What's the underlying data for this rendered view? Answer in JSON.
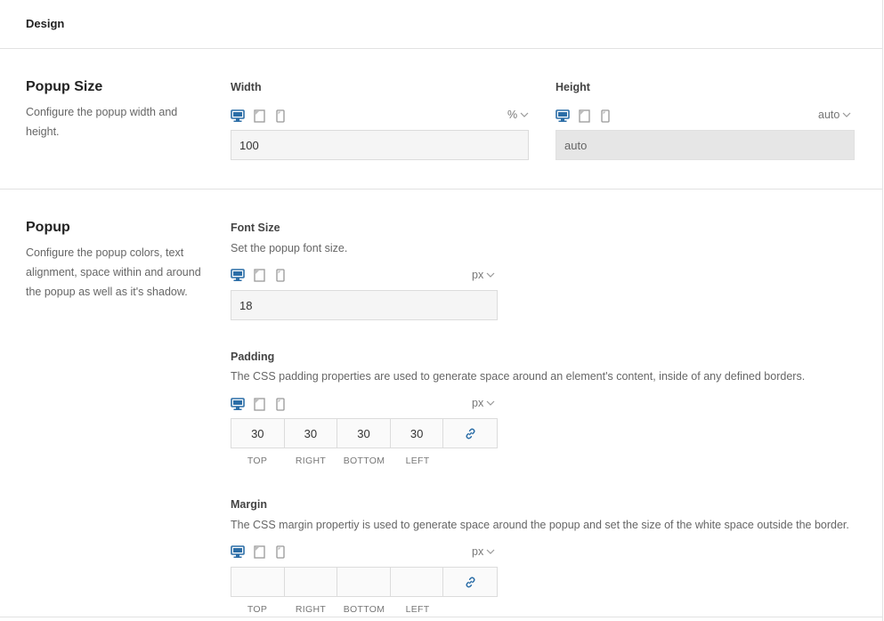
{
  "header": {
    "title": "Design"
  },
  "colors": {
    "accent": "#2c6ea7",
    "divider": "#e2e2e2",
    "input_bg": "#f5f5f5",
    "disabled_bg": "#e6e6e6"
  },
  "popup_size": {
    "title": "Popup Size",
    "description": "Configure the popup width and height.",
    "width": {
      "label": "Width",
      "unit": "%",
      "value": "100",
      "devices": [
        "desktop-icon",
        "tablet-icon",
        "mobile-icon"
      ]
    },
    "height": {
      "label": "Height",
      "unit": "auto",
      "value": "auto",
      "devices": [
        "desktop-icon",
        "tablet-icon",
        "mobile-icon"
      ]
    }
  },
  "popup": {
    "title": "Popup",
    "description": "Configure the popup colors, text alignment, space within and around the popup as well as it's shadow.",
    "font_size": {
      "label": "Font Size",
      "help": "Set the popup font size.",
      "unit": "px",
      "value": "18"
    },
    "padding": {
      "label": "Padding",
      "help": "The CSS padding properties are used to generate space around an element's content, inside of any defined borders.",
      "unit": "px",
      "values": {
        "top": "30",
        "right": "30",
        "bottom": "30",
        "left": "30"
      },
      "sides": {
        "top": "TOP",
        "right": "RIGHT",
        "bottom": "BOTTOM",
        "left": "LEFT"
      }
    },
    "margin": {
      "label": "Margin",
      "help": "The CSS margin propertiy is used to generate space around the popup and set the size of the white space outside the border.",
      "unit": "px",
      "values": {
        "top": "",
        "right": "",
        "bottom": "",
        "left": ""
      },
      "sides": {
        "top": "TOP",
        "right": "RIGHT",
        "bottom": "BOTTOM",
        "left": "LEFT"
      }
    }
  }
}
